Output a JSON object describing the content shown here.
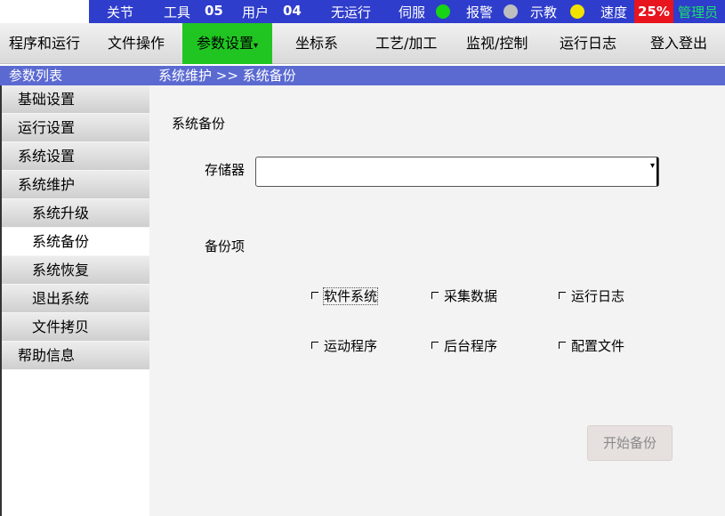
{
  "status": {
    "mode": "关节",
    "tool_label": "工具",
    "tool_value": "05",
    "user_label": "用户",
    "user_value": "04",
    "run_state": "无运行",
    "servo_label": "伺服",
    "servo_color": "#17d417",
    "alarm_label": "报警",
    "alarm_color": "#bfbfbf",
    "teach_label": "示教",
    "teach_color": "#f2e200",
    "speed_label": "速度",
    "speed_value": "25%",
    "role": "管理员"
  },
  "menu": {
    "items": [
      "程序和运行",
      "文件操作",
      "参数设置",
      "坐标系",
      "工艺/加工",
      "监视/控制",
      "运行日志",
      "登入登出"
    ],
    "active_caret": "▾"
  },
  "sidebar": {
    "header": "参数列表",
    "items": [
      "基础设置",
      "运行设置",
      "系统设置",
      "系统维护",
      "系统升级",
      "系统备份",
      "系统恢复",
      "退出系统",
      "文件拷贝",
      "帮助信息"
    ]
  },
  "content": {
    "breadcrumb": "系统维护 >> 系统备份",
    "title": "系统备份",
    "storage_label": "存储器",
    "storage_value": "",
    "backup_items_label": "备份项",
    "checkboxes": [
      "软件系统",
      "采集数据",
      "运行日志",
      "运动程序",
      "后台程序",
      "配置文件"
    ],
    "start_button": "开始备份"
  }
}
